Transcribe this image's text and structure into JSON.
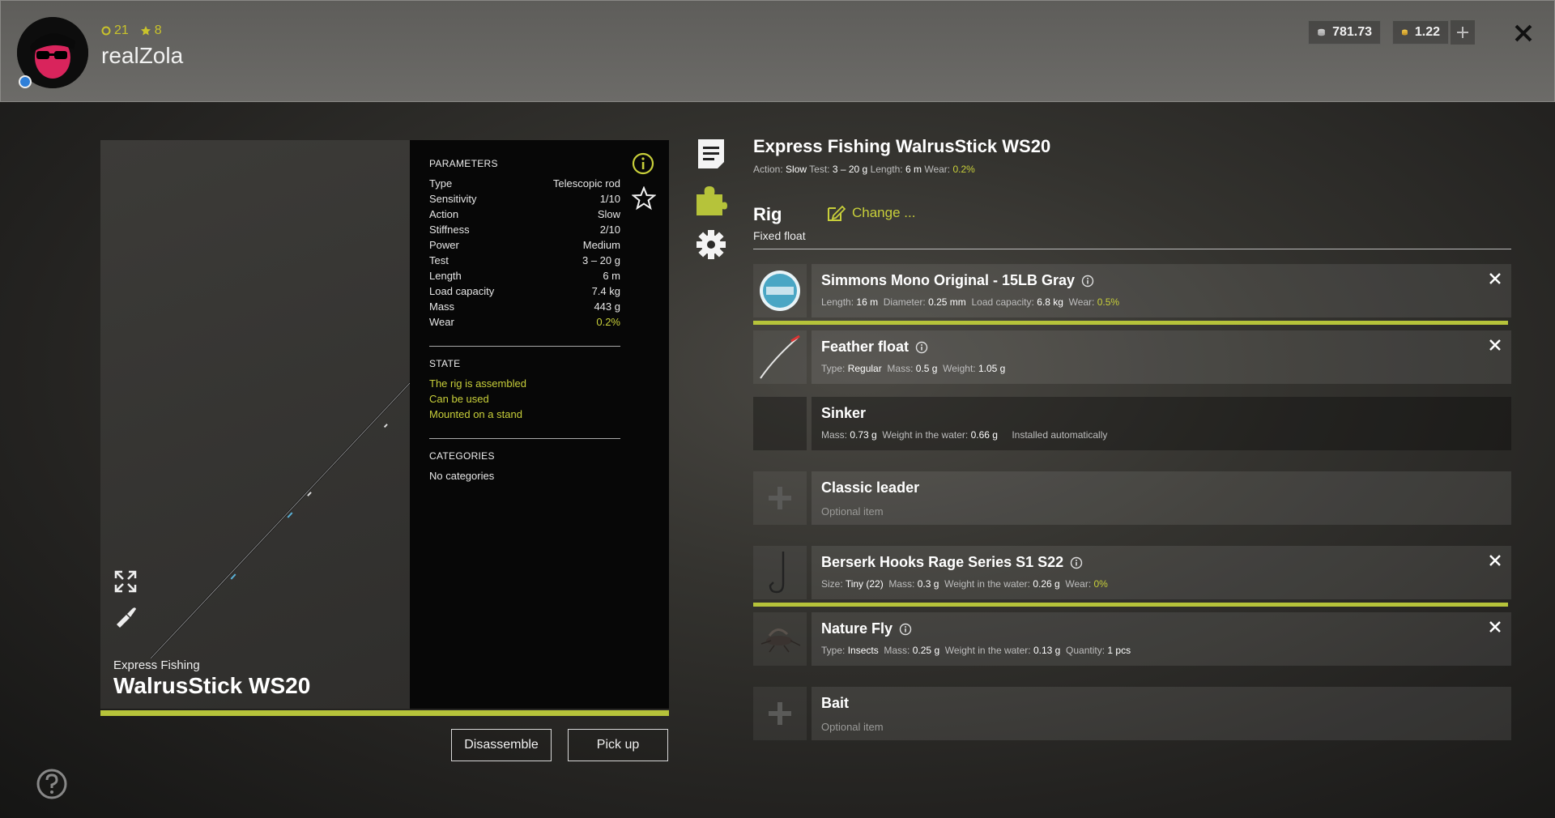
{
  "user": {
    "name": "realZola",
    "level": "21",
    "rank": "8"
  },
  "currency": {
    "silver": "781.73",
    "gold": "1.22"
  },
  "colors": {
    "accent": "#c8cf3a",
    "bar": "#b6c33a"
  },
  "preview": {
    "brand": "Express Fishing",
    "model": "WalrusStick WS20"
  },
  "parameters": {
    "title": "PARAMETERS",
    "rows": [
      {
        "label": "Type",
        "value": "Telescopic rod"
      },
      {
        "label": "Sensitivity",
        "value": "1/10"
      },
      {
        "label": "Action",
        "value": "Slow"
      },
      {
        "label": "Stiffness",
        "value": "2/10"
      },
      {
        "label": "Power",
        "value": "Medium"
      },
      {
        "label": "Test",
        "value": "3 – 20 g"
      },
      {
        "label": "Length",
        "value": "6 m"
      },
      {
        "label": "Load capacity",
        "value": "7.4 kg"
      },
      {
        "label": "Mass",
        "value": "443 g"
      },
      {
        "label": "Wear",
        "value": "0.2%"
      }
    ],
    "state_title": "STATE",
    "state": [
      "The rig is assembled",
      "Can be used",
      "Mounted on a stand"
    ],
    "categories_title": "CATEGORIES",
    "categories": "No categories"
  },
  "buttons": {
    "disassemble": "Disassemble",
    "pickup": "Pick up"
  },
  "item": {
    "title": "Express Fishing WalrusStick WS20",
    "action_label": "Action:",
    "action": "Slow",
    "test_label": "Test:",
    "test": "3 – 20 g",
    "length_label": "Length:",
    "length": "6 m",
    "wear_label": "Wear:",
    "wear": "0.2%"
  },
  "rig": {
    "title": "Rig",
    "type": "Fixed float",
    "change_label": "Change ..."
  },
  "slots": {
    "line": {
      "name": "Simmons Mono Original - 15LB Gray",
      "f": [
        {
          "label": "Length:",
          "value": "16 m"
        },
        {
          "label": "Diameter:",
          "value": "0.25 mm"
        },
        {
          "label": "Load capacity:",
          "value": "6.8 kg"
        },
        {
          "label": "Wear:",
          "value": "0.5%"
        }
      ]
    },
    "float": {
      "name": "Feather float",
      "f": [
        {
          "label": "Type:",
          "value": "Regular"
        },
        {
          "label": "Mass:",
          "value": "0.5 g"
        },
        {
          "label": "Weight:",
          "value": "1.05 g"
        }
      ]
    },
    "sinker": {
      "name": "Sinker",
      "f": [
        {
          "label": "Mass:",
          "value": "0.73 g"
        },
        {
          "label": "Weight in the water:",
          "value": "0.66 g"
        }
      ],
      "note": "Installed automatically"
    },
    "leader": {
      "name": "Classic leader",
      "optional": "Optional item"
    },
    "hook": {
      "name": "Berserk Hooks Rage Series S1 S22",
      "f": [
        {
          "label": "Size:",
          "value": "Tiny (22)"
        },
        {
          "label": "Mass:",
          "value": "0.3 g"
        },
        {
          "label": "Weight in the water:",
          "value": "0.26 g"
        },
        {
          "label": "Wear:",
          "value": "0%"
        }
      ]
    },
    "fly": {
      "name": "Nature Fly",
      "f": [
        {
          "label": "Type:",
          "value": "Insects"
        },
        {
          "label": "Mass:",
          "value": "0.25 g"
        },
        {
          "label": "Weight in the water:",
          "value": "0.13 g"
        },
        {
          "label": "Quantity:",
          "value": "1 pcs"
        }
      ]
    },
    "bait": {
      "name": "Bait",
      "optional": "Optional item"
    }
  }
}
